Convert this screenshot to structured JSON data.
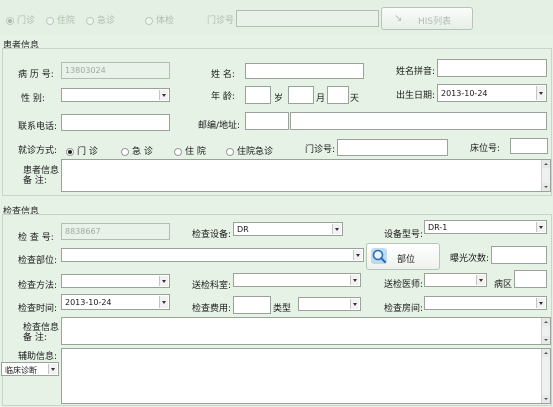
{
  "top": {
    "radio_options": [
      "门诊",
      "住院",
      "急诊",
      "体检"
    ],
    "outpatient_label": "门诊号",
    "his_button": "HIS列表"
  },
  "patient": {
    "section_title": "患者信息",
    "record_no_label": "病 历 号:",
    "record_no_value": "13803024",
    "name_label": "姓  名:",
    "pinyin_label": "姓名拼音:",
    "gender_label": "性   别:",
    "age_label": "年  龄:",
    "age_units": [
      "岁",
      "月",
      "天"
    ],
    "birthdate_label": "出生日期:",
    "birthdate_value": "2013-10-24",
    "phone_label": "联系电话:",
    "address_label": "邮编/地址:",
    "visit_type_label": "就诊方式:",
    "visit_types": [
      "门 诊",
      "急 诊",
      "住 院",
      "住院急诊"
    ],
    "outpatient_no_label": "门诊号:",
    "bed_no_label": "床位号:",
    "remark_label_1": "患者信息",
    "remark_label_2": "备    注:"
  },
  "exam": {
    "section_title": "检查信息",
    "exam_no_label": "检 查 号:",
    "exam_no_value": "8838667",
    "device_label": "检查设备:",
    "device_value": "DR",
    "device_model_label": "设备型号:",
    "device_model_value": "DR-1",
    "part_label": "检查部位:",
    "part_button": "部位",
    "exposure_label": "曝光次数:",
    "method_label": "检查方法:",
    "dept_label": "送检科室:",
    "doctor_label": "送检医师:",
    "ward_label": "病区",
    "time_label": "检查时间:",
    "time_value": "2013-10-24",
    "fee_label": "检查费用:",
    "type_label": "类型",
    "room_label": "检查房间:",
    "remark_label_1": "检查信息",
    "remark_label_2": "备    注:",
    "aux_label": "辅助信息:",
    "aux_select_value": "临床诊断"
  }
}
